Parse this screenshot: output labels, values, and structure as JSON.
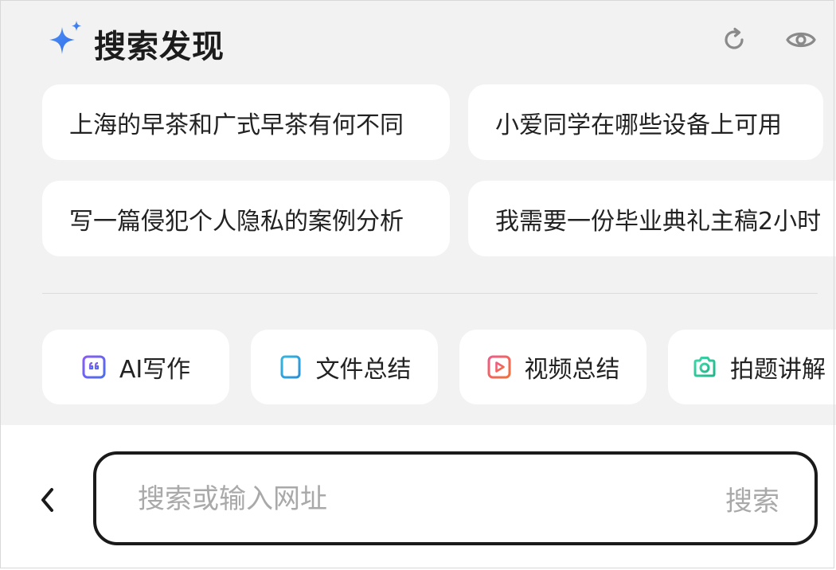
{
  "header": {
    "title": "搜索发现",
    "icons": [
      "sparkle-icon",
      "refresh-icon",
      "eye-icon"
    ]
  },
  "suggestions": [
    "上海的早茶和广式早茶有何不同",
    "小爱同学在哪些设备上可用",
    "写一篇侵犯个人隐私的案例分析",
    "我需要一份毕业典礼主稿2小时"
  ],
  "tools": [
    {
      "label": "AI写作",
      "icon": "quote-icon"
    },
    {
      "label": "文件总结",
      "icon": "document-icon"
    },
    {
      "label": "视频总结",
      "icon": "play-icon"
    },
    {
      "label": "拍题讲解",
      "icon": "camera-icon"
    }
  ],
  "search": {
    "placeholder": "搜索或输入网址",
    "button_label": "搜索"
  },
  "colors": {
    "background": "#f2f2f3",
    "sparkle": "#3b7cf0",
    "ai_writing": "#6b5cf0",
    "file_summary": "#2aa6d6",
    "video_summary": "#f0566a",
    "photo_explain": "#2ec79a"
  }
}
